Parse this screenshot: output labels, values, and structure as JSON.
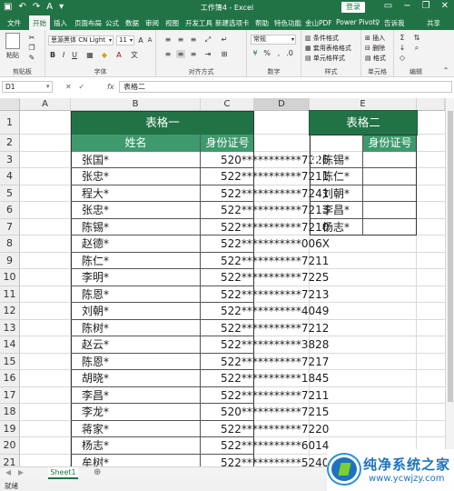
{
  "window": {
    "title": "工作簿4 - Excel",
    "login_label": "登录",
    "autosave_label": "关",
    "minimize_icon": "minimize-icon",
    "restore_icon": "restore-icon",
    "close_icon": "close-icon"
  },
  "ribbon_tabs": [
    {
      "label": "文件",
      "active": false
    },
    {
      "label": "开始",
      "active": true
    },
    {
      "label": "插入",
      "active": false
    },
    {
      "label": "页面布局",
      "active": false
    },
    {
      "label": "公式",
      "active": false
    },
    {
      "label": "数据",
      "active": false
    },
    {
      "label": "审阅",
      "active": false
    },
    {
      "label": "视图",
      "active": false
    },
    {
      "label": "开发工具",
      "active": false
    },
    {
      "label": "新建选项卡",
      "active": false
    },
    {
      "label": "帮助",
      "active": false
    },
    {
      "label": "特色功能",
      "active": false
    },
    {
      "label": "金山PDF",
      "active": false
    },
    {
      "label": "Power Pivot",
      "active": false
    }
  ],
  "tell_me": "告诉我",
  "share": "共享",
  "ribbon": {
    "clipboard": {
      "label": "剪贴板",
      "paste": "粘贴"
    },
    "font": {
      "label": "字体",
      "name": "思源黑体 CN Light",
      "size": "11"
    },
    "alignment": {
      "label": "对齐方式"
    },
    "number": {
      "label": "数字",
      "format": "常规"
    },
    "styles": {
      "label": "样式",
      "items": [
        "条件格式",
        "套用表格格式",
        "单元格样式"
      ]
    },
    "cells": {
      "label": "单元格",
      "items": [
        "插入",
        "删除",
        "格式"
      ]
    },
    "editing": {
      "label": "编辑"
    }
  },
  "formula_bar": {
    "name_box": "D1",
    "fx": "fx",
    "content": "表格二"
  },
  "columns": [
    {
      "label": "A",
      "selected": false
    },
    {
      "label": "B",
      "selected": false
    },
    {
      "label": "C",
      "selected": false
    },
    {
      "label": "D",
      "selected": true
    },
    {
      "label": "E",
      "selected": false
    }
  ],
  "rows": [
    "1",
    "2",
    "3",
    "4",
    "5",
    "6",
    "7",
    "8",
    "9",
    "10",
    "11",
    "12",
    "13",
    "14",
    "15",
    "16",
    "17",
    "18",
    "19",
    "20",
    "21"
  ],
  "table1": {
    "title": "表格一",
    "headers": [
      "姓名",
      "身份证号"
    ],
    "names": [
      "张国*",
      "张忠*",
      "程大*",
      "张忠*",
      "陈锡*",
      "赵德*",
      "陈仁*",
      "李明*",
      "陈恩*",
      "刘朝*",
      "陈树*",
      "赵云*",
      "陈恩*",
      "胡晓*",
      "李昌*",
      "李龙*",
      "蒋家*",
      "杨志*",
      "牟树*"
    ],
    "ids": [
      "520***********7226",
      "522***********7211",
      "522***********7241",
      "522***********7213",
      "522***********7210",
      "522***********006X",
      "522***********7211",
      "522***********7225",
      "522***********7213",
      "522***********4049",
      "522***********7212",
      "522***********3828",
      "522***********7217",
      "522***********1845",
      "522***********7211",
      "520***********7215",
      "522***********7220",
      "522***********6014",
      "522***********5240"
    ]
  },
  "table2": {
    "title": "表格二",
    "headers": [
      "姓名",
      "身份证号"
    ],
    "names": [
      "陈锡*",
      "陈仁*",
      "刘朝*",
      "李昌*",
      "杨志*"
    ]
  },
  "sheet_tabs": [
    {
      "label": "Sheet1",
      "active": true
    }
  ],
  "add_sheet_icon": "plus-icon",
  "status": {
    "text": "就绪"
  },
  "colors": {
    "accent": "#217346",
    "table_header": "#217346",
    "table_subheader": "#3e9a6d"
  },
  "watermark": {
    "brand": "纯净系统之家",
    "url": "www.ycwjzy.com"
  }
}
